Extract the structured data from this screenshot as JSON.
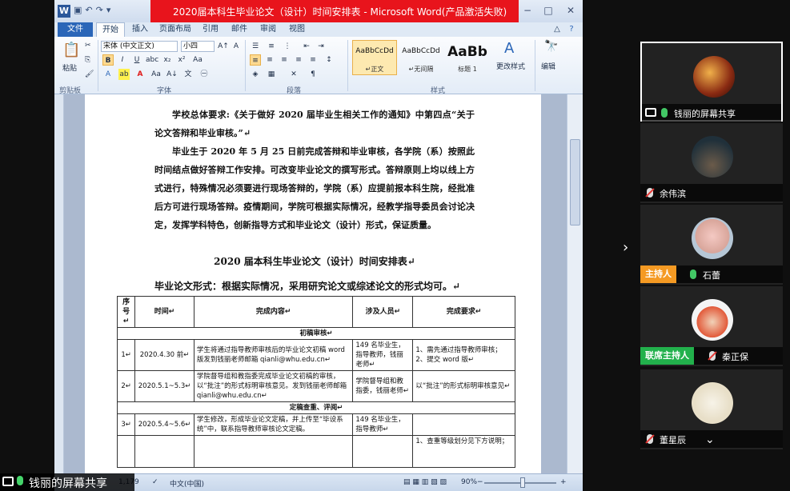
{
  "window": {
    "title": "2020届本科生毕业论文（设计）时间安排表 - Microsoft Word(产品激活失败)",
    "minimize": "−",
    "maximize": "□",
    "close": "✕"
  },
  "menu": {
    "file": "文件",
    "tabs": [
      "开始",
      "插入",
      "页面布局",
      "引用",
      "邮件",
      "审阅",
      "视图"
    ]
  },
  "ribbon": {
    "clipboard": {
      "paste": "粘贴",
      "label": "剪贴板"
    },
    "font": {
      "name": "宋体 (中文正文)",
      "size": "小四",
      "label": "字体"
    },
    "paragraph": {
      "label": "段落"
    },
    "styles": {
      "label": "样式",
      "items": [
        {
          "sample": "AaBbCcDd",
          "name": "↵正文"
        },
        {
          "sample": "AaBbCcDd",
          "name": "↵无间隔"
        },
        {
          "sample": "AaBb",
          "name": "标题 1"
        }
      ],
      "change": "更改样式"
    },
    "edit": {
      "label": "编辑"
    }
  },
  "document": {
    "para1": "学校总体要求:《关于做好 2020 届毕业生相关工作的通知》中第四点“关于论文答辩和毕业审核。”↵",
    "para2": "毕业生于 2020 年 5 月 25 日前完成答辩和毕业审核，各学院（系）按照此时间结点做好答辩工作安排。可改变毕业论文的撰写形式。答辩原则上均以线上方式进行，特殊情况必须要进行现场答辩的，学院（系）应提前报本科生院，经批准后方可进行现场答辩。疫情期间，学院可根据实际情况，经教学指导委员会讨论决定，发挥学科特色，创新指导方式和毕业论文（设计）形式，保证质量。",
    "title": "2020 届本科生毕业论文（设计）时间安排表↵",
    "subtitle": "毕业论文形式：根据实际情况，采用研究论文或综述论文的形式均可。↵",
    "table": {
      "headers": [
        "序号↵",
        "时间↵",
        "完成内容↵",
        "涉及人员↵",
        "完成要求↵"
      ],
      "section1": "初稿审核↵",
      "row1": [
        "1↵",
        "2020.4.30 前↵",
        "学生将通过指导教师审核后的毕业论文初稿 word 版发到钱丽老师邮箱 qianli@whu.edu.cn↵",
        "149 名毕业生，指导教师，钱丽老师↵",
        "1、需先通过指导教师审核；2、提交 word 版↵"
      ],
      "row2": [
        "2↵",
        "2020.5.1~5.3↵",
        "学院督导组和教指委完成毕业论文初稿的审核，以“批注”的形式标明审核意见。发到钱丽老师邮箱 qianli@whu.edu.cn↵",
        "学院督导组和教指委，钱丽老师↵",
        "以“批注”的形式标明审核意见↵"
      ],
      "section2": "定稿查重、评阅↵",
      "row3": [
        "3↵",
        "2020.5.4~5.6↵",
        "学生修改，形成毕业论文定稿，并上传至“毕设系统”中，联系指导教师审核论文定稿。",
        "149 名毕业生，指导教师↵",
        ""
      ],
      "row4": [
        "",
        "",
        "",
        "",
        "1、查重等级划分见下方说明；"
      ]
    }
  },
  "status": {
    "words": "1,179",
    "lang": "中文(中国)",
    "zoom": "90%",
    "minus": "−",
    "plus": "+"
  },
  "meeting": {
    "share_banner": "钱丽的屏幕共享",
    "panels": [
      {
        "name": "钱丽的屏幕共享"
      },
      {
        "name": "余伟滨"
      },
      {
        "name": "石蕾",
        "role": "主持人"
      },
      {
        "name": "秦正保",
        "role": "联席主持人"
      },
      {
        "name": "董星辰"
      }
    ],
    "next_arrow": "›",
    "more_arrow": "⌄"
  }
}
